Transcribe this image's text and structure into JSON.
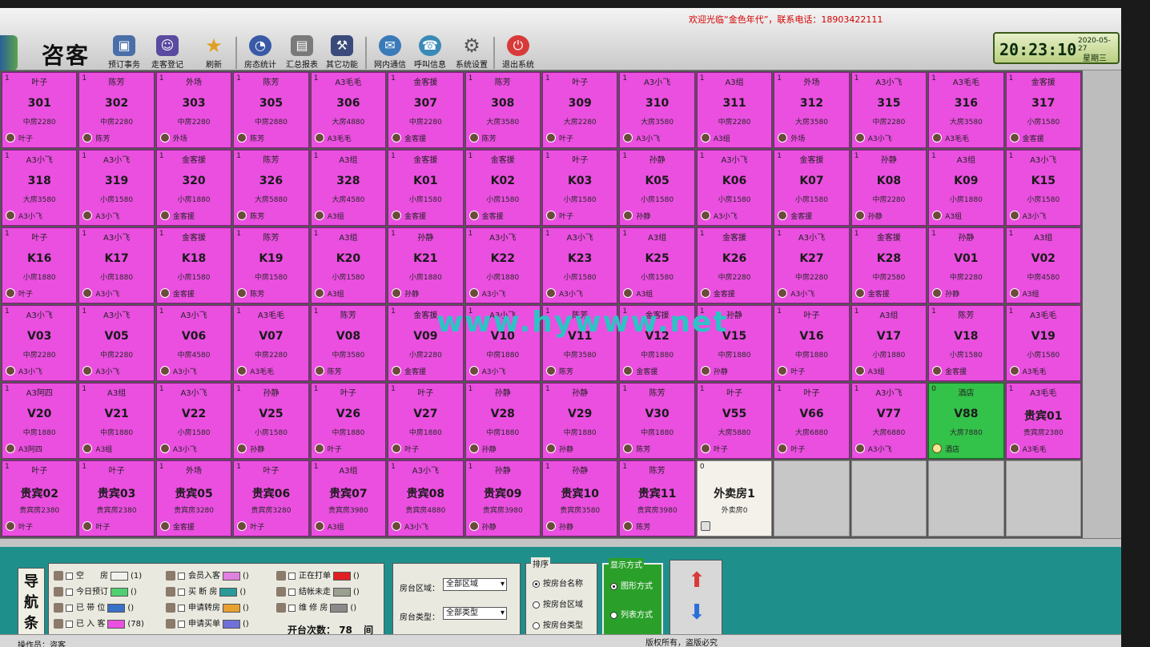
{
  "header": {
    "title": "咨客",
    "welcome": "欢迎光临“金色年代”，联系电话：18903422111",
    "toolbar": [
      {
        "label": "预订事务",
        "icon": "booking-icon",
        "color": "#4a6fa8"
      },
      {
        "label": "走客登记",
        "icon": "walk-icon",
        "color": "#5a4aa0"
      },
      {
        "label": "刷新",
        "icon": "star-icon",
        "color": "#e0a020"
      },
      {
        "label": "房态统计",
        "icon": "stats-icon",
        "color": "#3a5aa8"
      },
      {
        "label": "汇总报表",
        "icon": "report-icon",
        "color": "#6a6a6a"
      },
      {
        "label": "其它功能",
        "icon": "tools-icon",
        "color": "#3a4a7a"
      },
      {
        "label": "网内通信",
        "icon": "chat-icon",
        "color": "#3a7ab8"
      },
      {
        "label": "呼叫信息",
        "icon": "call-icon",
        "color": "#3a8ab8"
      },
      {
        "label": "系统设置",
        "icon": "gear-icon",
        "color": "#6a6a6a"
      },
      {
        "label": "退出系统",
        "icon": "exit-icon",
        "color": "#d83a3a"
      }
    ],
    "clock": {
      "time": "20:23:10",
      "date": "2020-05-27",
      "weekday": "星期三"
    }
  },
  "rooms": [
    {
      "num": "1",
      "name": "叶子",
      "code": "301",
      "type": "中房2280",
      "owner": "叶子"
    },
    {
      "num": "1",
      "name": "陈芳",
      "code": "302",
      "type": "中房2280",
      "owner": "陈芳"
    },
    {
      "num": "1",
      "name": "外场",
      "code": "303",
      "type": "中房2280",
      "owner": "外场"
    },
    {
      "num": "1",
      "name": "陈芳",
      "code": "305",
      "type": "中房2880",
      "owner": "陈芳"
    },
    {
      "num": "1",
      "name": "A3毛毛",
      "code": "306",
      "type": "大房4880",
      "owner": "A3毛毛"
    },
    {
      "num": "1",
      "name": "金客援",
      "code": "307",
      "type": "中房2280",
      "owner": "金客援"
    },
    {
      "num": "1",
      "name": "陈芳",
      "code": "308",
      "type": "大房3580",
      "owner": "陈芳"
    },
    {
      "num": "1",
      "name": "叶子",
      "code": "309",
      "type": "大房2280",
      "owner": "叶子"
    },
    {
      "num": "1",
      "name": "A3小飞",
      "code": "310",
      "type": "大房3580",
      "owner": "A3小飞"
    },
    {
      "num": "1",
      "name": "A3组",
      "code": "311",
      "type": "中房2280",
      "owner": "A3组"
    },
    {
      "num": "1",
      "name": "外场",
      "code": "312",
      "type": "大房3580",
      "owner": "外场"
    },
    {
      "num": "1",
      "name": "A3小飞",
      "code": "315",
      "type": "中房2280",
      "owner": "A3小飞"
    },
    {
      "num": "1",
      "name": "A3毛毛",
      "code": "316",
      "type": "大房3580",
      "owner": "A3毛毛"
    },
    {
      "num": "1",
      "name": "金客援",
      "code": "317",
      "type": "小房1580",
      "owner": "金客援"
    },
    {
      "num": "1",
      "name": "A3小飞",
      "code": "318",
      "type": "大房3580",
      "owner": "A3小飞"
    },
    {
      "num": "1",
      "name": "A3小飞",
      "code": "319",
      "type": "小房1580",
      "owner": "A3小飞"
    },
    {
      "num": "1",
      "name": "金客援",
      "code": "320",
      "type": "小房1880",
      "owner": "金客援"
    },
    {
      "num": "1",
      "name": "陈芳",
      "code": "326",
      "type": "大房5880",
      "owner": "陈芳"
    },
    {
      "num": "1",
      "name": "A3组",
      "code": "328",
      "type": "大房4580",
      "owner": "A3组"
    },
    {
      "num": "1",
      "name": "金客援",
      "code": "K01",
      "type": "小房1580",
      "owner": "金客援"
    },
    {
      "num": "1",
      "name": "金客援",
      "code": "K02",
      "type": "小房1580",
      "owner": "金客援"
    },
    {
      "num": "1",
      "name": "叶子",
      "code": "K03",
      "type": "小房1580",
      "owner": "叶子"
    },
    {
      "num": "1",
      "name": "孙静",
      "code": "K05",
      "type": "小房1580",
      "owner": "孙静"
    },
    {
      "num": "1",
      "name": "A3小飞",
      "code": "K06",
      "type": "小房1580",
      "owner": "A3小飞"
    },
    {
      "num": "1",
      "name": "金客援",
      "code": "K07",
      "type": "小房1580",
      "owner": "金客援"
    },
    {
      "num": "1",
      "name": "孙静",
      "code": "K08",
      "type": "中房2280",
      "owner": "孙静"
    },
    {
      "num": "1",
      "name": "A3组",
      "code": "K09",
      "type": "小房1880",
      "owner": "A3组"
    },
    {
      "num": "1",
      "name": "A3小飞",
      "code": "K15",
      "type": "小房1580",
      "owner": "A3小飞"
    },
    {
      "num": "1",
      "name": "叶子",
      "code": "K16",
      "type": "小房1880",
      "owner": "叶子"
    },
    {
      "num": "1",
      "name": "A3小飞",
      "code": "K17",
      "type": "小房1880",
      "owner": "A3小飞"
    },
    {
      "num": "1",
      "name": "金客援",
      "code": "K18",
      "type": "小房1580",
      "owner": "金客援"
    },
    {
      "num": "1",
      "name": "陈芳",
      "code": "K19",
      "type": "中房1580",
      "owner": "陈芳"
    },
    {
      "num": "1",
      "name": "A3组",
      "code": "K20",
      "type": "小房1580",
      "owner": "A3组"
    },
    {
      "num": "1",
      "name": "孙静",
      "code": "K21",
      "type": "小房1880",
      "owner": "孙静"
    },
    {
      "num": "1",
      "name": "A3小飞",
      "code": "K22",
      "type": "小房1880",
      "owner": "A3小飞"
    },
    {
      "num": "1",
      "name": "A3小飞",
      "code": "K23",
      "type": "小房1580",
      "owner": "A3小飞"
    },
    {
      "num": "1",
      "name": "A3组",
      "code": "K25",
      "type": "小房1580",
      "owner": "A3组"
    },
    {
      "num": "1",
      "name": "金客援",
      "code": "K26",
      "type": "中房2280",
      "owner": "金客援"
    },
    {
      "num": "1",
      "name": "A3小飞",
      "code": "K27",
      "type": "中房2280",
      "owner": "A3小飞"
    },
    {
      "num": "1",
      "name": "金客援",
      "code": "K28",
      "type": "中房2580",
      "owner": "金客援"
    },
    {
      "num": "1",
      "name": "孙静",
      "code": "V01",
      "type": "中房2280",
      "owner": "孙静"
    },
    {
      "num": "1",
      "name": "A3组",
      "code": "V02",
      "type": "中房4580",
      "owner": "A3组"
    },
    {
      "num": "1",
      "name": "A3小飞",
      "code": "V03",
      "type": "中房2280",
      "owner": "A3小飞"
    },
    {
      "num": "1",
      "name": "A3小飞",
      "code": "V05",
      "type": "中房2280",
      "owner": "A3小飞"
    },
    {
      "num": "1",
      "name": "A3小飞",
      "code": "V06",
      "type": "中房4580",
      "owner": "A3小飞"
    },
    {
      "num": "1",
      "name": "A3毛毛",
      "code": "V07",
      "type": "中房2280",
      "owner": "A3毛毛"
    },
    {
      "num": "1",
      "name": "陈芳",
      "code": "V08",
      "type": "中房3580",
      "owner": "陈芳"
    },
    {
      "num": "1",
      "name": "金客援",
      "code": "V09",
      "type": "小房2280",
      "owner": "金客援"
    },
    {
      "num": "1",
      "name": "A3小飞",
      "code": "V10",
      "type": "中房1880",
      "owner": "A3小飞"
    },
    {
      "num": "1",
      "name": "陈芳",
      "code": "V11",
      "type": "中房3580",
      "owner": "陈芳"
    },
    {
      "num": "1",
      "name": "金客援",
      "code": "V12",
      "type": "中房1880",
      "owner": "金客援"
    },
    {
      "num": "1",
      "name": "孙静",
      "code": "V15",
      "type": "中房1880",
      "owner": "孙静"
    },
    {
      "num": "1",
      "name": "叶子",
      "code": "V16",
      "type": "中房1880",
      "owner": "叶子"
    },
    {
      "num": "1",
      "name": "A3组",
      "code": "V17",
      "type": "小房1880",
      "owner": "A3组"
    },
    {
      "num": "1",
      "name": "陈芳",
      "code": "V18",
      "type": "小房1580",
      "owner": "金客援"
    },
    {
      "num": "1",
      "name": "A3毛毛",
      "code": "V19",
      "type": "小房1580",
      "owner": "A3毛毛"
    },
    {
      "num": "1",
      "name": "A3阿四",
      "code": "V20",
      "type": "中房1880",
      "owner": "A3阿四"
    },
    {
      "num": "1",
      "name": "A3组",
      "code": "V21",
      "type": "中房1880",
      "owner": "A3组"
    },
    {
      "num": "1",
      "name": "A3小飞",
      "code": "V22",
      "type": "小房1580",
      "owner": "A3小飞"
    },
    {
      "num": "1",
      "name": "孙静",
      "code": "V25",
      "type": "小房1580",
      "owner": "孙静"
    },
    {
      "num": "1",
      "name": "叶子",
      "code": "V26",
      "type": "中房1880",
      "owner": "叶子"
    },
    {
      "num": "1",
      "name": "叶子",
      "code": "V27",
      "type": "中房1880",
      "owner": "叶子"
    },
    {
      "num": "1",
      "name": "孙静",
      "code": "V28",
      "type": "中房1880",
      "owner": "孙静"
    },
    {
      "num": "1",
      "name": "孙静",
      "code": "V29",
      "type": "中房1880",
      "owner": "孙静"
    },
    {
      "num": "1",
      "name": "陈芳",
      "code": "V30",
      "type": "中房1880",
      "owner": "陈芳"
    },
    {
      "num": "1",
      "name": "叶子",
      "code": "V55",
      "type": "大房5880",
      "owner": "叶子"
    },
    {
      "num": "1",
      "name": "叶子",
      "code": "V66",
      "type": "大房6880",
      "owner": "叶子"
    },
    {
      "num": "1",
      "name": "A3小飞",
      "code": "V77",
      "type": "大房6880",
      "owner": "A3小飞"
    },
    {
      "num": "0",
      "name": "酒店",
      "code": "V88",
      "type": "大房7880",
      "owner": "酒店",
      "state": "green"
    },
    {
      "num": "1",
      "name": "A3毛毛",
      "code": "贵宾01",
      "type": "贵宾房2380",
      "owner": "A3毛毛"
    },
    {
      "num": "1",
      "name": "叶子",
      "code": "贵宾02",
      "type": "贵宾房2380",
      "owner": "叶子"
    },
    {
      "num": "1",
      "name": "叶子",
      "code": "贵宾03",
      "type": "贵宾房2380",
      "owner": "叶子"
    },
    {
      "num": "1",
      "name": "外场",
      "code": "贵宾05",
      "type": "贵宾房3280",
      "owner": "金客援"
    },
    {
      "num": "1",
      "name": "叶子",
      "code": "贵宾06",
      "type": "贵宾房3280",
      "owner": "叶子"
    },
    {
      "num": "1",
      "name": "A3组",
      "code": "贵宾07",
      "type": "贵宾房3980",
      "owner": "A3组"
    },
    {
      "num": "1",
      "name": "A3小飞",
      "code": "贵宾08",
      "type": "贵宾房4880",
      "owner": "A3小飞"
    },
    {
      "num": "1",
      "name": "孙静",
      "code": "贵宾09",
      "type": "贵宾房3980",
      "owner": "孙静"
    },
    {
      "num": "1",
      "name": "孙静",
      "code": "贵宾10",
      "type": "贵宾房3580",
      "owner": "孙静"
    },
    {
      "num": "1",
      "name": "陈芳",
      "code": "贵宾11",
      "type": "贵宾房3980",
      "owner": "陈芳"
    },
    {
      "num": "0",
      "name": "",
      "code": "外卖房1",
      "type": "外卖房0",
      "owner": "",
      "state": "white"
    }
  ],
  "legend": {
    "items": [
      {
        "label": "空　　房",
        "count": "1",
        "color": "#f2f2ec"
      },
      {
        "label": "今日预订",
        "count": "",
        "color": "#4fd070"
      },
      {
        "label": "已 带 位",
        "count": "",
        "color": "#3a70c8"
      },
      {
        "label": "已 入 客",
        "count": "78",
        "color": "#ea4fe0"
      },
      {
        "label": "会员入客",
        "count": "",
        "color": "#e080e0"
      },
      {
        "label": "买 断 房",
        "count": "",
        "color": "#2a9a9a"
      },
      {
        "label": "申请转房",
        "count": "",
        "color": "#e8a030"
      },
      {
        "label": "申请买单",
        "count": "",
        "color": "#7070d8"
      },
      {
        "label": "正在打单",
        "count": "",
        "color": "#e02020"
      },
      {
        "label": "结帐未走",
        "count": "",
        "color": "#9aa090"
      },
      {
        "label": "维 修 房",
        "count": "",
        "color": "#8a8a8a"
      }
    ],
    "open_count_label": "开台次数：",
    "open_count": "78",
    "open_count_unit": "间"
  },
  "nav_label": "导航条",
  "filter": {
    "area_label": "房台区域：",
    "area_value": "全部区域",
    "type_label": "房台类型：",
    "type_value": "全部类型"
  },
  "sort": {
    "title": "排序",
    "options": [
      "按房台名称",
      "按房台区域",
      "按房台类型"
    ],
    "selected": 0
  },
  "display": {
    "title": "显示方式",
    "options": [
      "图形方式",
      "列表方式"
    ],
    "selected": 0
  },
  "status": {
    "copyright": "版权所有，盗版必究",
    "operator": "操作员：咨客"
  },
  "watermark": "www.hywww.net"
}
